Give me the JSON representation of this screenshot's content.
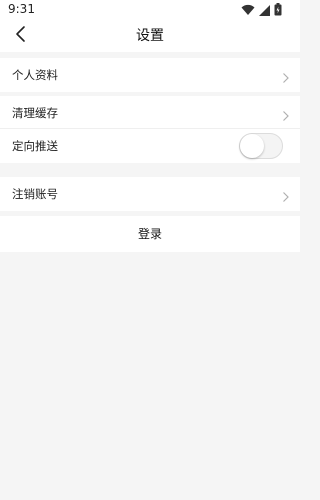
{
  "status_bar": {
    "time": "9:31",
    "icons": [
      "wifi-icon",
      "signal-icon",
      "battery-icon"
    ]
  },
  "header": {
    "title": "设置",
    "back_icon": "back-arrow-icon"
  },
  "settings": {
    "profile_label": "个人资料",
    "clear_cache_label": "清理缓存",
    "targeted_push_label": "定向推送",
    "targeted_push_enabled": false,
    "cancel_account_label": "注销账号"
  },
  "login": {
    "label": "登录"
  },
  "colors": {
    "background": "#f5f5f5",
    "card": "#ffffff",
    "text": "#222222",
    "chevron": "#b0b0b0"
  }
}
